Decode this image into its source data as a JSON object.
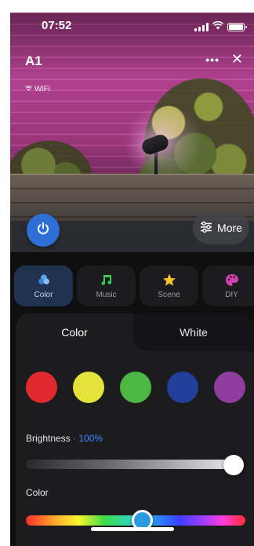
{
  "status_bar": {
    "time": "07:52"
  },
  "header": {
    "device_name": "A1",
    "more_label": "•••",
    "close_label": "✕"
  },
  "connection": {
    "label": "WiFi"
  },
  "hero_controls": {
    "more_button_label": "More"
  },
  "modes": [
    {
      "label": "Color",
      "icon": "color-icon",
      "active": true
    },
    {
      "label": "Music",
      "icon": "music-icon",
      "active": false
    },
    {
      "label": "Scene",
      "icon": "star-icon",
      "active": false
    },
    {
      "label": "DIY",
      "icon": "palette-icon",
      "active": false
    }
  ],
  "panel": {
    "tabs": [
      {
        "label": "Color",
        "active": true
      },
      {
        "label": "White",
        "active": false
      }
    ],
    "swatches": [
      "#e02a2f",
      "#e4e33a",
      "#4cb843",
      "#223f9b",
      "#8e3c9e"
    ],
    "brightness": {
      "label": "Brightness",
      "separator": "·",
      "value_text": "100%",
      "value": 1.0
    },
    "color": {
      "label": "Color",
      "hue_position": 0.53
    }
  },
  "colors": {
    "accent": "#2e6fd6",
    "accent_text": "#3c8bff",
    "background": "#0f0f10",
    "panel": "#1c1c1f"
  }
}
